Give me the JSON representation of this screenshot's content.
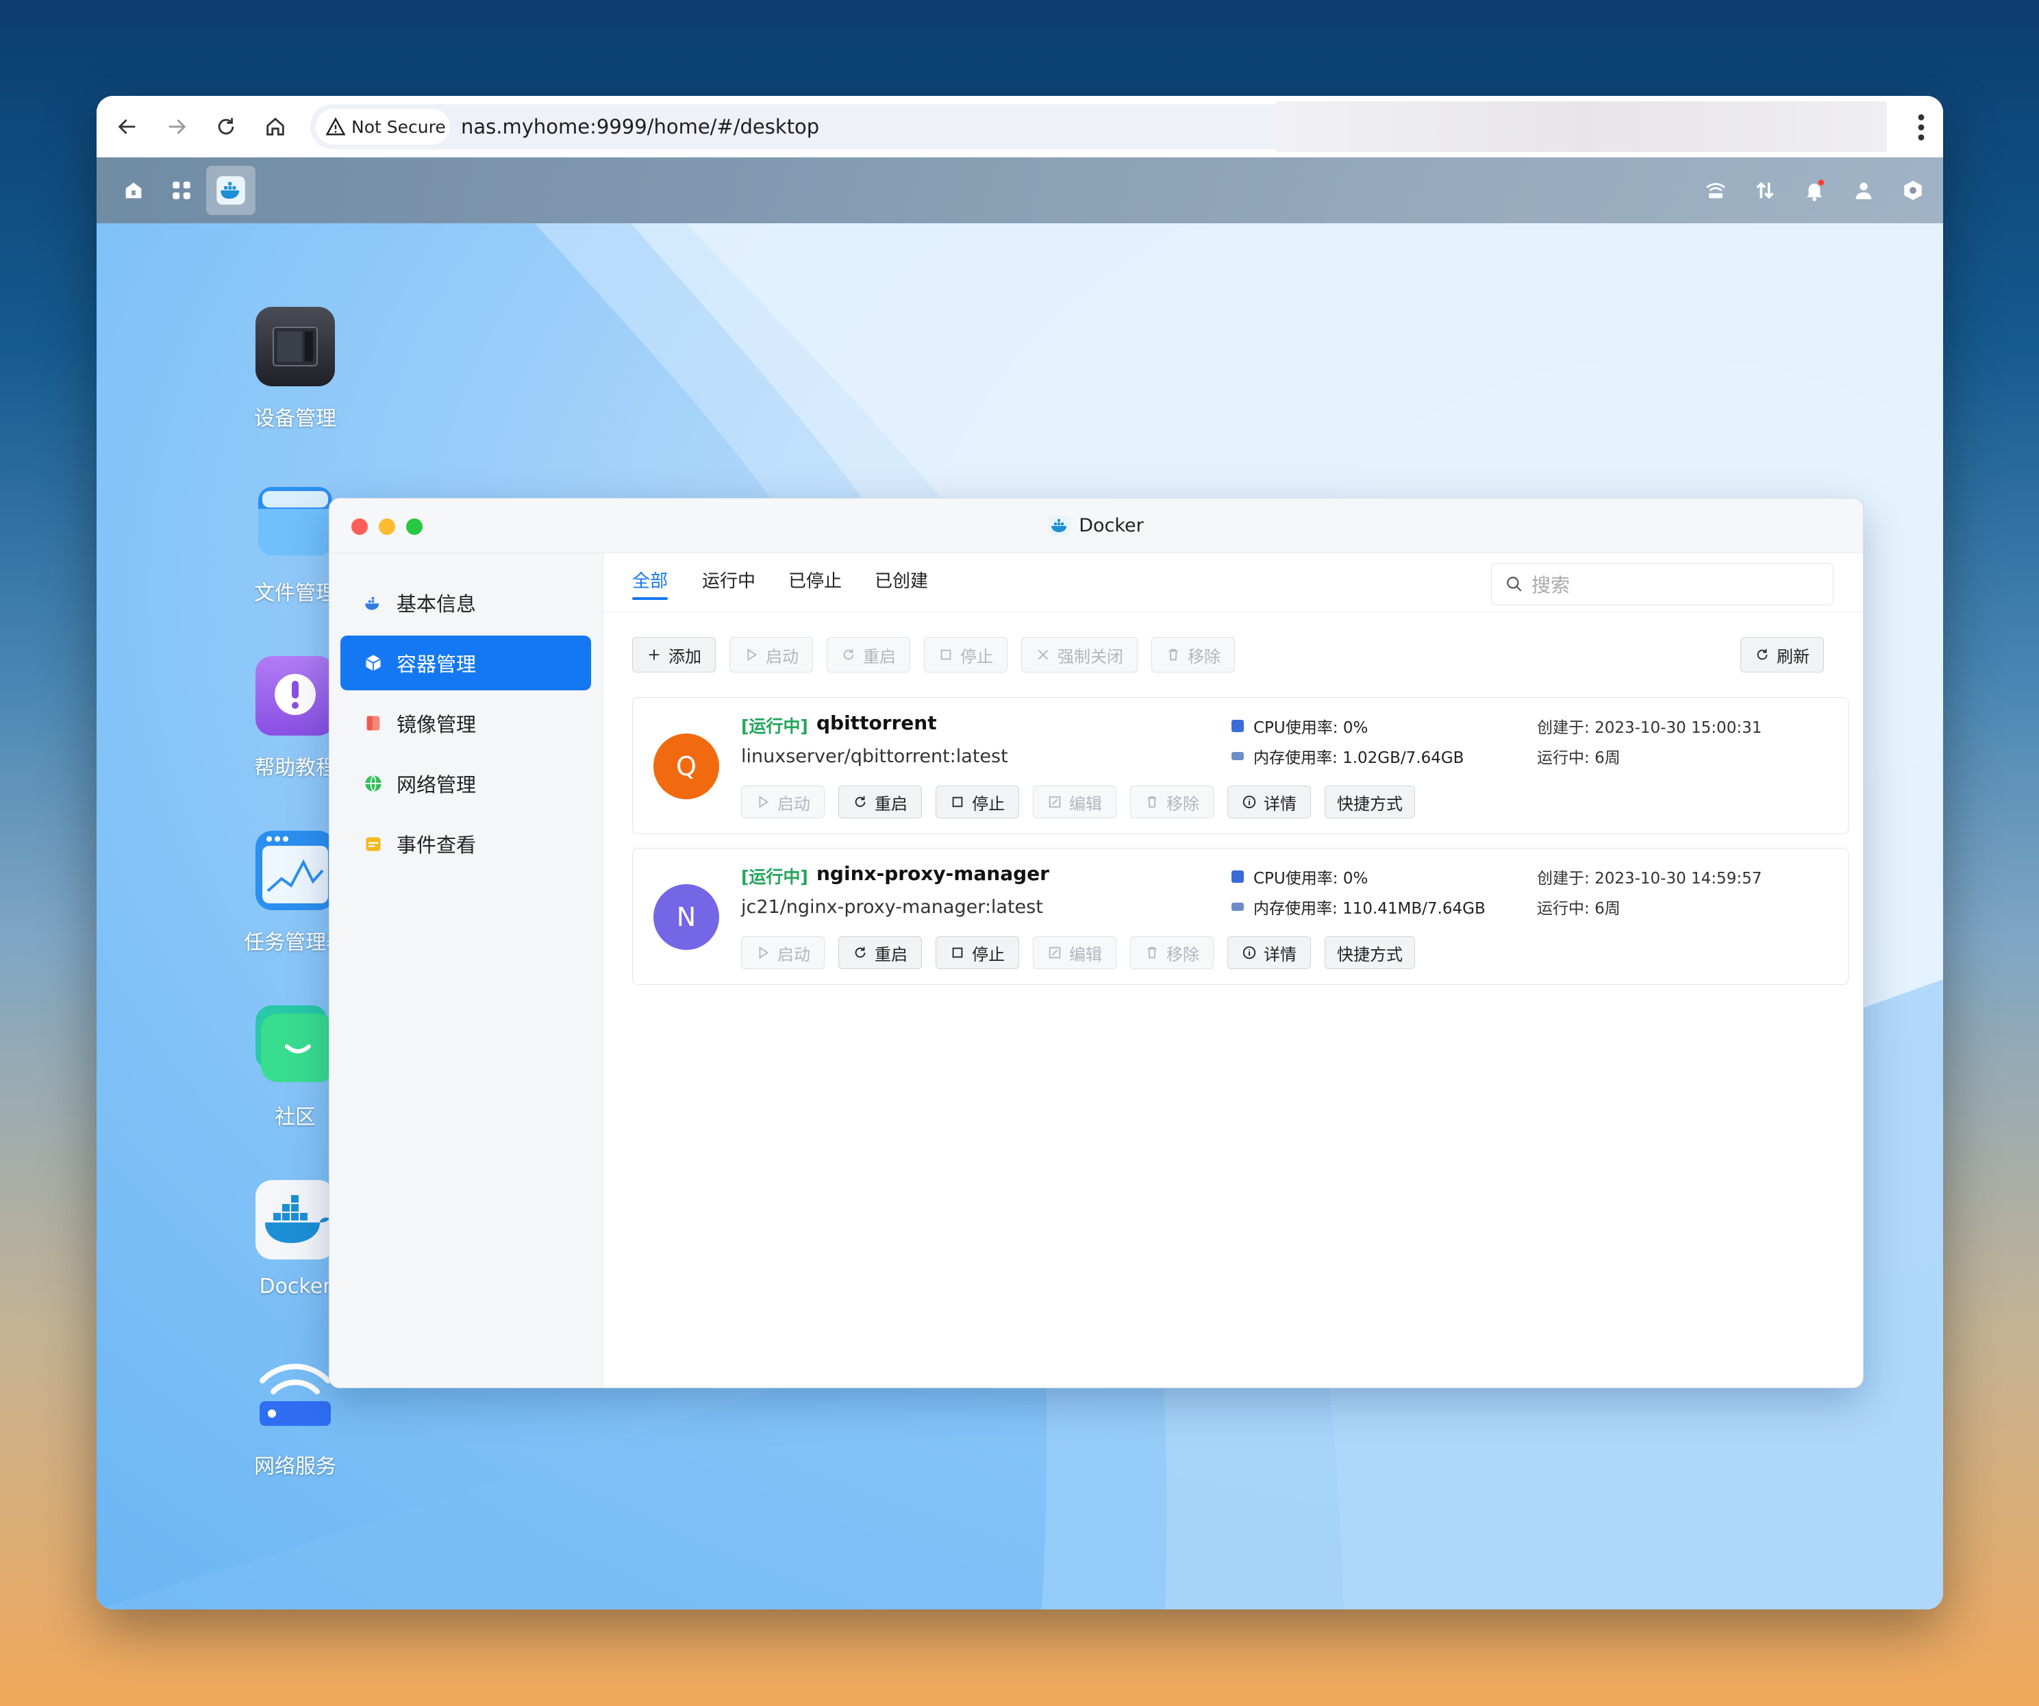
{
  "browser": {
    "secure_label": "Not Secure",
    "url": "nas.myhome:9999/home/#/desktop"
  },
  "desktop_apps": [
    {
      "label": "设备管理"
    },
    {
      "label": "文件管理"
    },
    {
      "label": "帮助教程"
    },
    {
      "label": "任务管理器"
    },
    {
      "label": "社区"
    },
    {
      "label": "Docker"
    },
    {
      "label": "网络服务"
    }
  ],
  "app": {
    "title": "Docker",
    "sidebar": [
      {
        "label": "基本信息"
      },
      {
        "label": "容器管理"
      },
      {
        "label": "镜像管理"
      },
      {
        "label": "网络管理"
      },
      {
        "label": "事件查看"
      }
    ],
    "tabs": [
      "全部",
      "运行中",
      "已停止",
      "已创建"
    ],
    "search_placeholder": "搜索",
    "toolbar": {
      "add": "添加",
      "start": "启动",
      "restart": "重启",
      "stop": "停止",
      "force_close": "强制关闭",
      "remove": "移除",
      "refresh": "刷新"
    },
    "cpu_label": "CPU使用率:",
    "mem_label": "内存使用率:",
    "created_label": "创建于:",
    "uptime_label": "运行中:",
    "card_buttons": {
      "start": "启动",
      "restart": "重启",
      "stop": "停止",
      "edit": "编辑",
      "remove": "移除",
      "details": "详情",
      "shortcut": "快捷方式"
    },
    "containers": [
      {
        "avatar": "Q",
        "avatar_color": "#f26a10",
        "status": "[运行中]",
        "name": "qbittorrent",
        "image": "linuxserver/qbittorrent:latest",
        "cpu": "0%",
        "mem": "1.02GB/7.64GB",
        "created": "2023-10-30 15:00:31",
        "uptime": "6周"
      },
      {
        "avatar": "N",
        "avatar_color": "#7466e4",
        "status": "[运行中]",
        "name": "nginx-proxy-manager",
        "image": "jc21/nginx-proxy-manager:latest",
        "cpu": "0%",
        "mem": "110.41MB/7.64GB",
        "created": "2023-10-30 14:59:57",
        "uptime": "6周"
      }
    ]
  },
  "colors": {
    "accent": "#1578f3",
    "running": "#22a55a"
  }
}
